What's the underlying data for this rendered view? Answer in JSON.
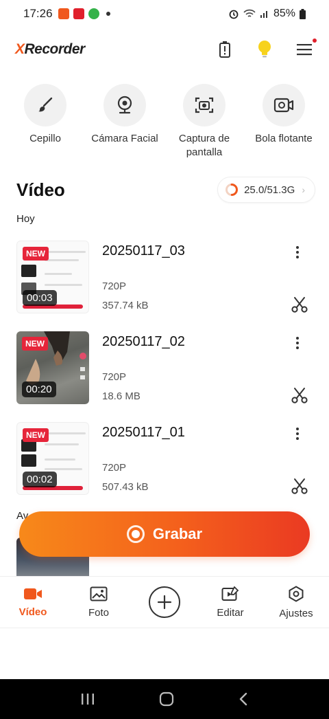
{
  "status_bar": {
    "time": "17:26",
    "battery": "85%"
  },
  "app": {
    "logo_x": "X",
    "logo_rest": "Recorder"
  },
  "tools": [
    {
      "label": "Cepillo",
      "icon": "brush-icon"
    },
    {
      "label": "Cámara Facial",
      "icon": "webcam-icon"
    },
    {
      "label": "Captura de pantalla",
      "icon": "screenshot-icon"
    },
    {
      "label": "Bola flotante",
      "icon": "floating-ball-icon"
    }
  ],
  "section": {
    "title": "Vídeo",
    "storage": "25.0/51.3G",
    "storage_used_fraction": 0.49
  },
  "group_label": "Hoy",
  "videos": [
    {
      "name": "20250117_03",
      "badge": "NEW",
      "duration": "00:03",
      "resolution": "720P",
      "size": "357.74 kB"
    },
    {
      "name": "20250117_02",
      "badge": "NEW",
      "duration": "00:20",
      "resolution": "720P",
      "size": "18.6 MB"
    },
    {
      "name": "20250117_01",
      "badge": "NEW",
      "duration": "00:02",
      "resolution": "720P",
      "size": "507.43 kB"
    }
  ],
  "partial_group_label": "Av",
  "record_button": {
    "label": "Grabar"
  },
  "bottom_nav": [
    {
      "label": "Vídeo",
      "icon": "video-camera-icon",
      "active": true
    },
    {
      "label": "Foto",
      "icon": "photo-icon",
      "active": false
    },
    {
      "label": "",
      "icon": "plus-circle-icon",
      "active": false
    },
    {
      "label": "Editar",
      "icon": "edit-video-icon",
      "active": false
    },
    {
      "label": "Ajustes",
      "icon": "settings-hexagon-icon",
      "active": false
    }
  ],
  "colors": {
    "accent": "#f0581d",
    "badge_red": "#e6253a",
    "gradient_start": "#f7891a",
    "gradient_end": "#ea3a22"
  }
}
